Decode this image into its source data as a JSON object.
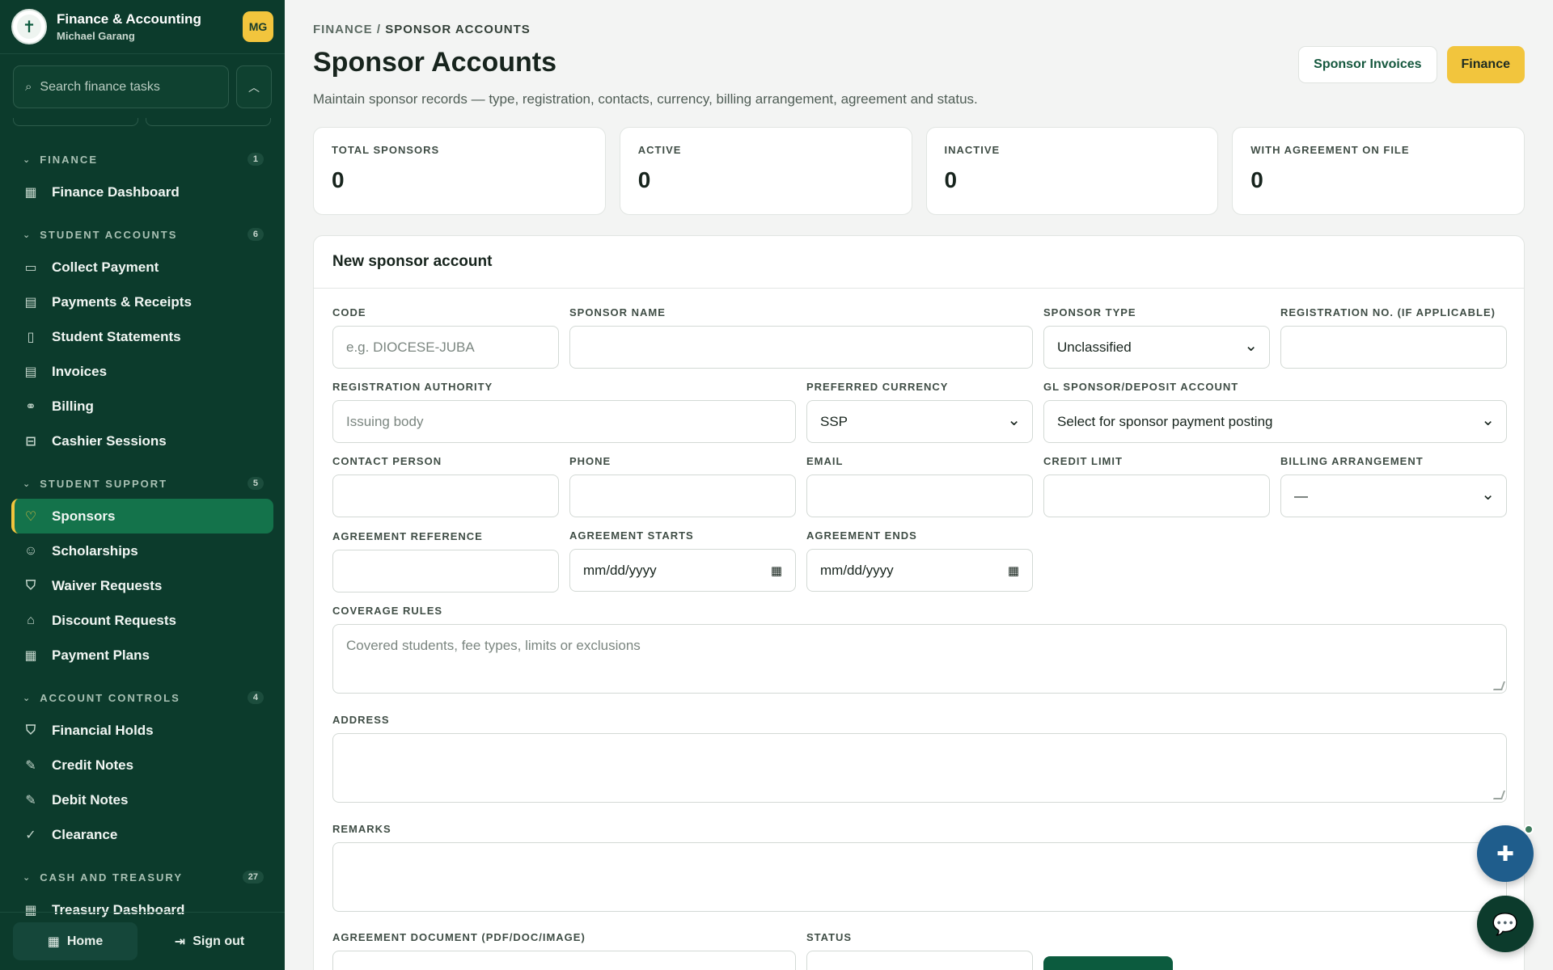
{
  "app": {
    "title": "Finance & Accounting",
    "user": "Michael Garang",
    "avatar": "MG"
  },
  "sidebar": {
    "search_placeholder": "Search finance tasks",
    "groups": [
      {
        "title": "FINANCE",
        "count": "1",
        "items": [
          {
            "label": "Finance Dashboard",
            "icon": "grid-icon"
          }
        ]
      },
      {
        "title": "STUDENT ACCOUNTS",
        "count": "6",
        "items": [
          {
            "label": "Collect Payment",
            "icon": "card-icon"
          },
          {
            "label": "Payments & Receipts",
            "icon": "receipt-icon"
          },
          {
            "label": "Student Statements",
            "icon": "statement-icon"
          },
          {
            "label": "Invoices",
            "icon": "invoice-icon"
          },
          {
            "label": "Billing",
            "icon": "coins-icon"
          },
          {
            "label": "Cashier Sessions",
            "icon": "register-icon"
          }
        ]
      },
      {
        "title": "STUDENT SUPPORT",
        "count": "5",
        "items": [
          {
            "label": "Sponsors",
            "icon": "handshake-icon",
            "active": true
          },
          {
            "label": "Scholarships",
            "icon": "users-icon"
          },
          {
            "label": "Waiver Requests",
            "icon": "shield-check-icon"
          },
          {
            "label": "Discount Requests",
            "icon": "tag-icon"
          },
          {
            "label": "Payment Plans",
            "icon": "calendar-icon"
          }
        ]
      },
      {
        "title": "ACCOUNT CONTROLS",
        "count": "4",
        "items": [
          {
            "label": "Financial Holds",
            "icon": "shield-check-icon"
          },
          {
            "label": "Credit Notes",
            "icon": "pen-icon"
          },
          {
            "label": "Debit Notes",
            "icon": "pen-icon"
          },
          {
            "label": "Clearance",
            "icon": "check-circle-icon"
          }
        ]
      },
      {
        "title": "CASH AND TREASURY",
        "count": "27",
        "items": [
          {
            "label": "Treasury Dashboard",
            "icon": "grid-icon"
          }
        ]
      }
    ],
    "footer": {
      "home": "Home",
      "signout": "Sign out"
    }
  },
  "header": {
    "breadcrumb_root": "FINANCE",
    "breadcrumb_sep": " / ",
    "breadcrumb_current": "SPONSOR ACCOUNTS",
    "title": "Sponsor Accounts",
    "subtitle": "Maintain sponsor records — type, registration, contacts, currency, billing arrangement, agreement and status.",
    "btn_invoices": "Sponsor Invoices",
    "btn_finance": "Finance"
  },
  "stats": [
    {
      "label": "TOTAL SPONSORS",
      "value": "0"
    },
    {
      "label": "ACTIVE",
      "value": "0"
    },
    {
      "label": "INACTIVE",
      "value": "0"
    },
    {
      "label": "WITH AGREEMENT ON FILE",
      "value": "0"
    }
  ],
  "form": {
    "title": "New sponsor account",
    "code_label": "CODE",
    "code_placeholder": "e.g. DIOCESE-JUBA",
    "name_label": "SPONSOR NAME",
    "type_label": "SPONSOR TYPE",
    "type_value": "Unclassified",
    "regno_label": "REGISTRATION NO. (IF APPLICABLE)",
    "regauth_label": "REGISTRATION AUTHORITY",
    "regauth_placeholder": "Issuing body",
    "currency_label": "PREFERRED CURRENCY",
    "currency_value": "SSP",
    "gl_label": "GL SPONSOR/DEPOSIT ACCOUNT",
    "gl_value": "Select for sponsor payment posting",
    "contact_label": "CONTACT PERSON",
    "phone_label": "PHONE",
    "email_label": "EMAIL",
    "credit_label": "CREDIT LIMIT",
    "billing_label": "BILLING ARRANGEMENT",
    "billing_value": "—",
    "agref_label": "AGREEMENT REFERENCE",
    "agstart_label": "AGREEMENT STARTS",
    "agstart_value": "mm/dd/yyyy",
    "agend_label": "AGREEMENT ENDS",
    "agend_value": "mm/dd/yyyy",
    "coverage_label": "COVERAGE RULES",
    "coverage_placeholder": "Covered students, fee types, limits or exclusions",
    "address_label": "ADDRESS",
    "remarks_label": "REMARKS",
    "doc_label": "AGREEMENT DOCUMENT (PDF/DOC/IMAGE)",
    "status_label": "STATUS"
  }
}
